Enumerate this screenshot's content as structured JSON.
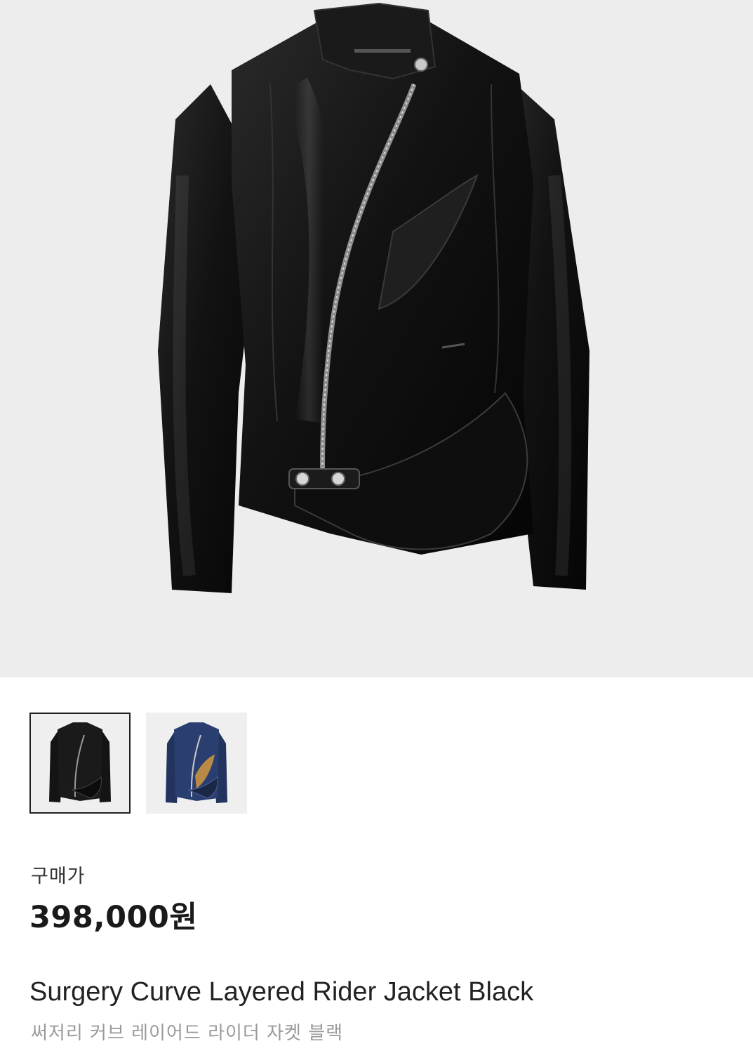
{
  "product": {
    "main_image": {
      "icon": "leather-rider-jacket-black",
      "background": "#ededed",
      "jacket_color": "#151515"
    },
    "thumbnails": [
      {
        "icon": "jacket-black-thumbnail",
        "color": "#141414",
        "selected": true
      },
      {
        "icon": "jacket-navy-thumbnail",
        "color": "#22345e",
        "selected": false
      }
    ],
    "price_label": "구매가",
    "price": "398,000원",
    "name_en": "Surgery Curve Layered Rider Jacket Black",
    "name_ko": "써저리 커브 레이어드 라이더 자켓 블랙"
  }
}
